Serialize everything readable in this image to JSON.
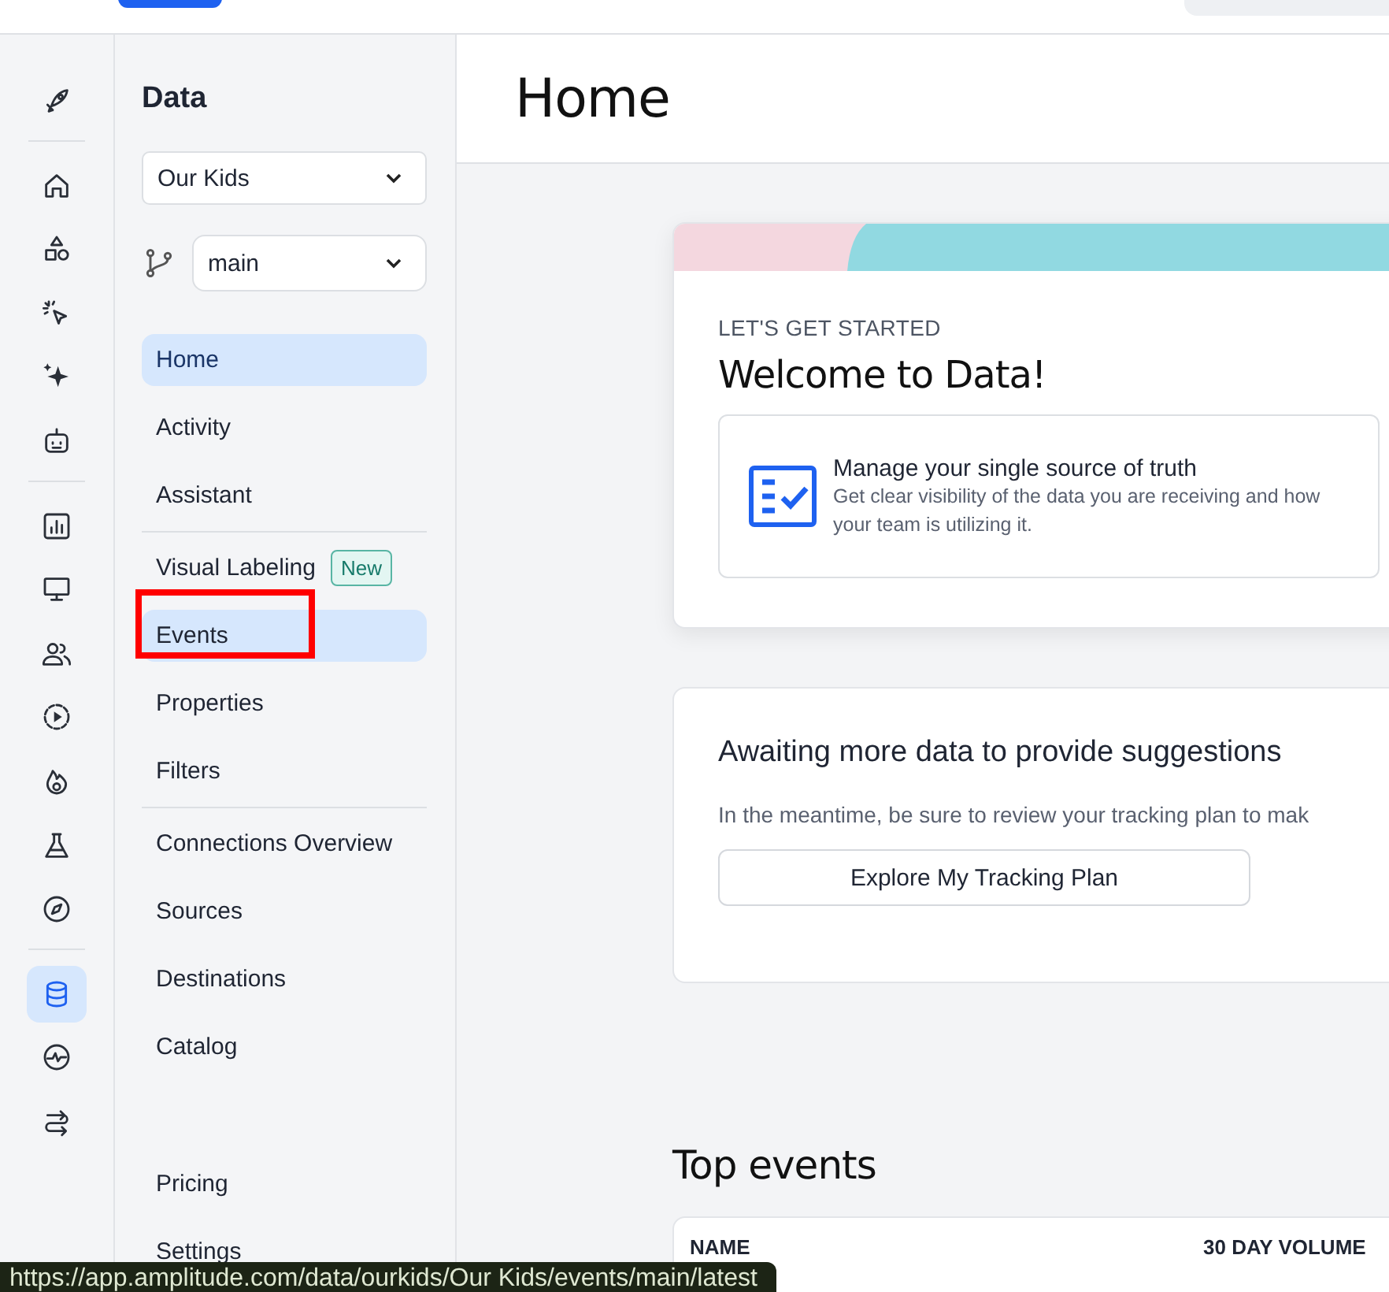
{
  "rail": {
    "groups": [
      {
        "items": [
          {
            "selected": false
          }
        ]
      },
      {
        "items": [
          {
            "selected": false
          },
          {
            "selected": false
          },
          {
            "selected": false
          },
          {
            "selected": false
          },
          {
            "selected": false
          }
        ]
      },
      {
        "items": [
          {
            "selected": false
          },
          {
            "selected": false
          },
          {
            "selected": false
          },
          {
            "selected": false
          },
          {
            "selected": false
          },
          {
            "selected": false
          },
          {
            "selected": false
          }
        ]
      },
      {
        "items": [
          {
            "selected": true
          },
          {
            "selected": false
          },
          {
            "selected": false
          }
        ]
      }
    ]
  },
  "sidebar": {
    "title": "Data",
    "project": {
      "value": "Our Kids"
    },
    "branch": {
      "value": "main"
    },
    "groups": [
      {
        "items": [
          {
            "label": "Home",
            "selected": true,
            "hovered": false,
            "highlighted": false
          },
          {
            "label": "Activity",
            "selected": false,
            "hovered": false,
            "highlighted": false
          },
          {
            "label": "Assistant",
            "selected": false,
            "hovered": false,
            "highlighted": false
          }
        ]
      },
      {
        "items": [
          {
            "label": "Visual Labeling",
            "badge": "New",
            "selected": false,
            "hovered": false,
            "highlighted": false
          },
          {
            "label": "Events",
            "selected": false,
            "hovered": true,
            "highlighted": true
          },
          {
            "label": "Properties",
            "selected": false,
            "hovered": false,
            "highlighted": false
          },
          {
            "label": "Filters",
            "selected": false,
            "hovered": false,
            "highlighted": false
          }
        ]
      },
      {
        "items": [
          {
            "label": "Connections Overview",
            "selected": false,
            "hovered": false,
            "highlighted": false
          },
          {
            "label": "Sources",
            "selected": false,
            "hovered": false,
            "highlighted": false
          },
          {
            "label": "Destinations",
            "selected": false,
            "hovered": false,
            "highlighted": false
          },
          {
            "label": "Catalog",
            "selected": false,
            "hovered": false,
            "highlighted": false
          }
        ]
      }
    ],
    "footer_items": [
      {
        "label": "Pricing",
        "selected": false
      },
      {
        "label": "Settings",
        "selected": false
      }
    ]
  },
  "page": {
    "title": "Home",
    "welcome": {
      "eyebrow": "LET'S GET STARTED",
      "title": "Welcome to Data!",
      "feature": {
        "title": "Manage your single source of truth",
        "text": "Get clear visibility of the data you are receiving and how your team is utilizing it."
      }
    },
    "suggestions": {
      "title": "Awaiting more data to provide suggestions",
      "text": "In the meantime, be sure to review your tracking plan to mak",
      "button": "Explore My Tracking Plan"
    },
    "top_events": {
      "title": "Top events",
      "columns": [
        "NAME",
        "30 DAY VOLUME"
      ]
    }
  },
  "status_url": "https://app.amplitude.com/data/ourkids/Our Kids/events/main/latest"
}
